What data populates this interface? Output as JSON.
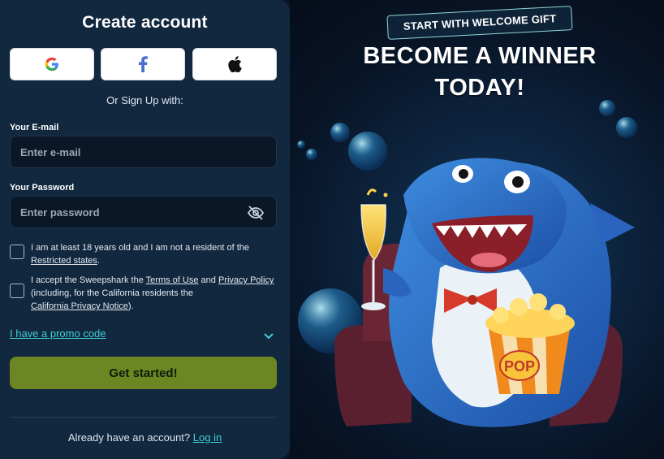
{
  "form": {
    "title": "Create account",
    "social_buttons": [
      {
        "name": "google-icon"
      },
      {
        "name": "facebook-icon"
      },
      {
        "name": "apple-icon"
      }
    ],
    "or_text": "Or Sign Up with:",
    "email": {
      "label": "Your E-mail",
      "placeholder": "Enter e-mail",
      "value": ""
    },
    "password": {
      "label": "Your Password",
      "placeholder": "Enter password",
      "value": ""
    },
    "age_check": {
      "text": "I am at least 18 years old and I am not a resident of the",
      "link": "Restricted states",
      "suffix": ".",
      "checked": false
    },
    "terms_check": {
      "prefix": "I accept the Sweepshark the",
      "link1": "Terms of Use",
      "and": "and",
      "link2": "Privacy Policy",
      "middle": "(including, for the California residents the",
      "link3": "California Privacy Notice",
      "suffix": ").",
      "checked": false
    },
    "promo_label": "I have a promo code",
    "submit_label": "Get started!",
    "login_prompt": "Already have an account?",
    "login_link": "Log in"
  },
  "hero": {
    "badge": "START WITH WELCOME GIFT",
    "headline_line1": "BECOME A WINNER",
    "headline_line2": "TODAY!",
    "popcorn_label": "POP"
  },
  "colors": {
    "panel_bg": "#12283f",
    "accent_link": "#3fd0d6",
    "cta_bg": "#6b8623",
    "field_bg": "#0a1726"
  }
}
